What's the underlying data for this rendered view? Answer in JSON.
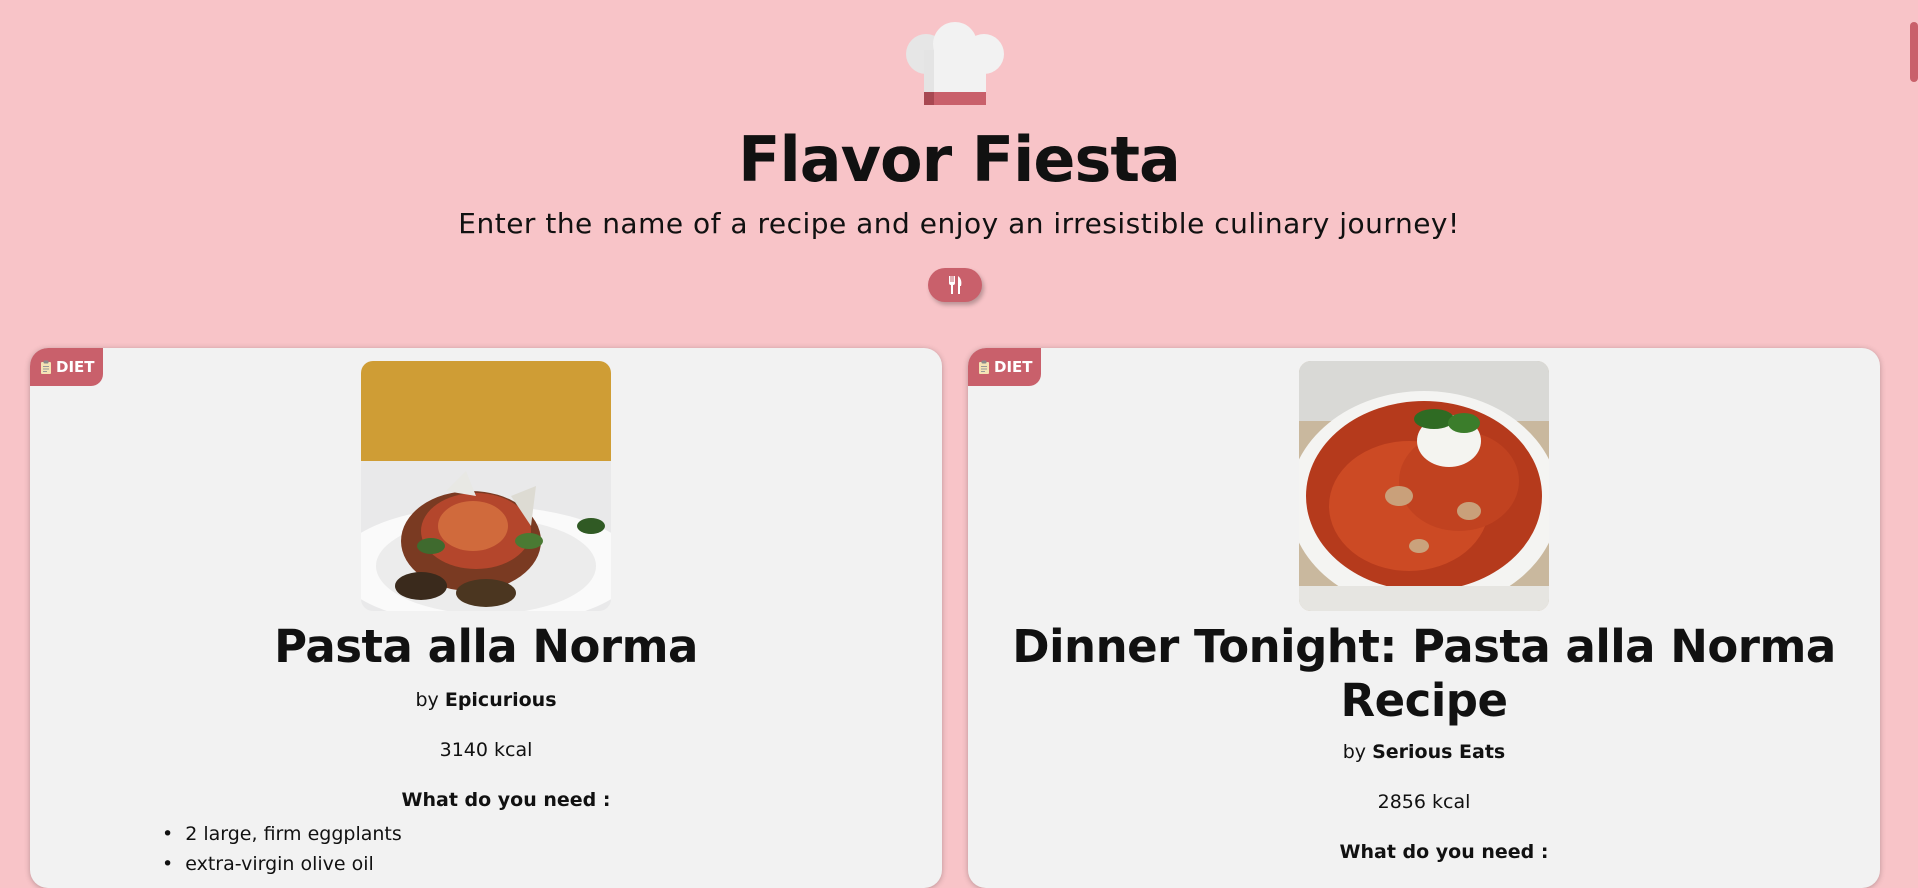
{
  "header": {
    "title": "Flavor Fiesta",
    "subtitle": "Enter the name of a recipe and enjoy an irresistible culinary journey!",
    "logo_icon": "chef-hat-icon",
    "action_icon": "fork-knife-icon"
  },
  "colors": {
    "background": "#f8c4c8",
    "accent": "#c9606b",
    "card": "#f2f2f2"
  },
  "recipes": [
    {
      "badge": "DIET",
      "badge_icon": "clipboard-icon",
      "title": "Pasta alla Norma",
      "by_label": "by",
      "source": "Epicurious",
      "calories": "3140 kcal",
      "need_label": "What do you need :",
      "ingredients": [
        "2 large, firm eggplants",
        "extra-virgin olive oil"
      ]
    },
    {
      "badge": "DIET",
      "badge_icon": "clipboard-icon",
      "title": "Dinner Tonight: Pasta alla Norma Recipe",
      "by_label": "by",
      "source": "Serious Eats",
      "calories": "2856 kcal",
      "need_label": "What do you need :",
      "ingredients": []
    }
  ]
}
